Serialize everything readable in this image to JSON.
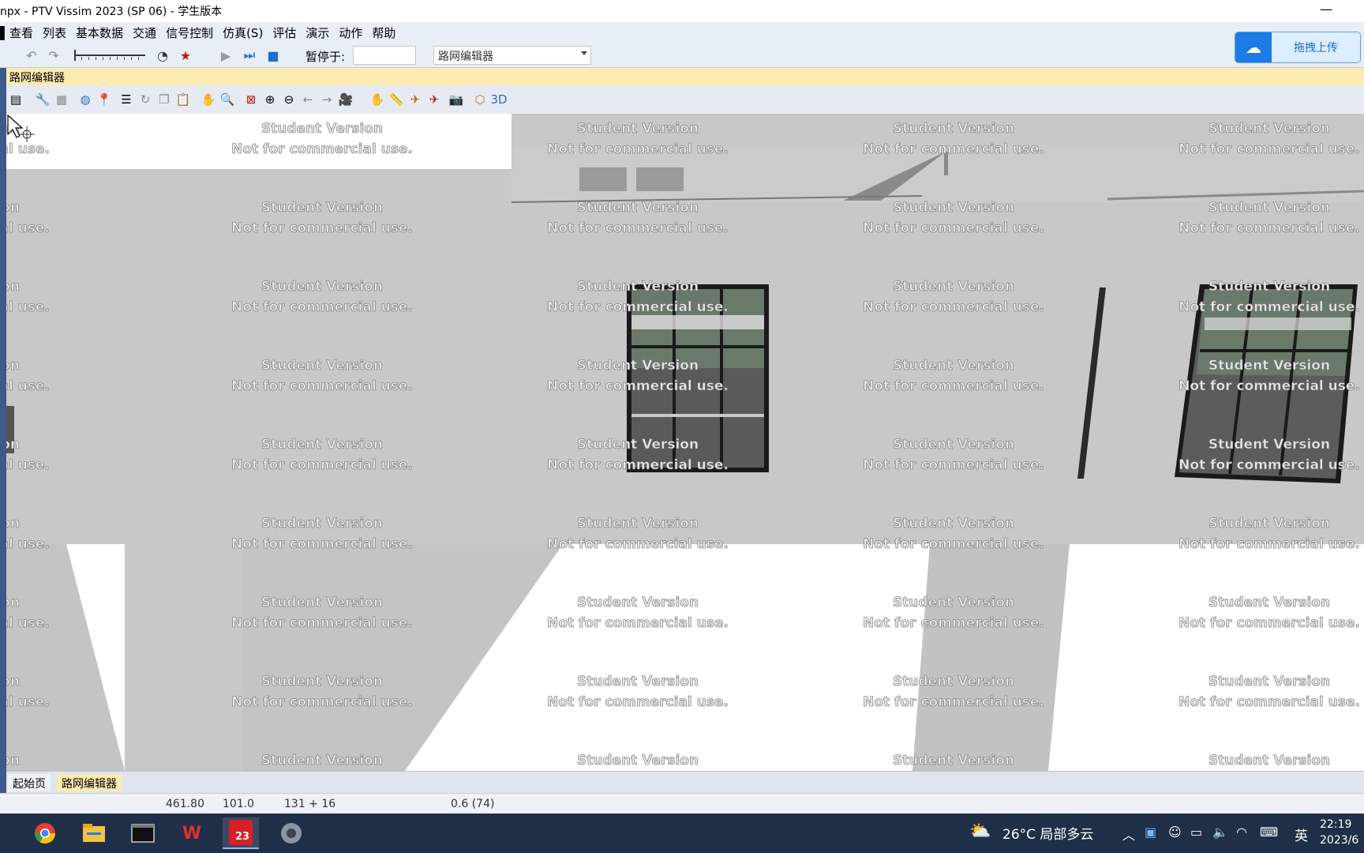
{
  "window": {
    "title": "npx - PTV Vissim 2023 (SP 06) - 学生版本",
    "minimize_icon": "minimize-icon"
  },
  "menu": {
    "items": [
      "查看",
      "列表",
      "基本数据",
      "交通",
      "信号控制",
      "仿真(S)",
      "评估",
      "演示",
      "动作",
      "帮助"
    ],
    "left_fragment": "看"
  },
  "toolbar": {
    "pause_label": "暂停于:",
    "pause_value": "",
    "view_select_value": "路网编辑器"
  },
  "upload_button": {
    "label": "拖拽上传",
    "icon": "cloud-upload-icon",
    "accent": "#1b7ce6"
  },
  "editor": {
    "header_title": "路网编辑器",
    "header_color": "#fdeab0"
  },
  "watermark": {
    "line1": "Student Version",
    "line2": "Not for commercial use."
  },
  "tabs": {
    "start_page": "起始页",
    "network_editor": "路网编辑器"
  },
  "status": {
    "x": "461.80",
    "y": "101.0",
    "counts": "131 + 16",
    "zoom": "0.6 (74)"
  },
  "taskbar": {
    "apps": [
      "chrome-icon",
      "file-explorer-icon",
      "terminal-icon",
      "wps-icon",
      "vissim-icon",
      "app-icon"
    ],
    "vissim_badge": "23",
    "weather_temp": "26°C",
    "weather_desc": "局部多云",
    "ime": "英",
    "time": "22:19",
    "date": "2023/6"
  }
}
